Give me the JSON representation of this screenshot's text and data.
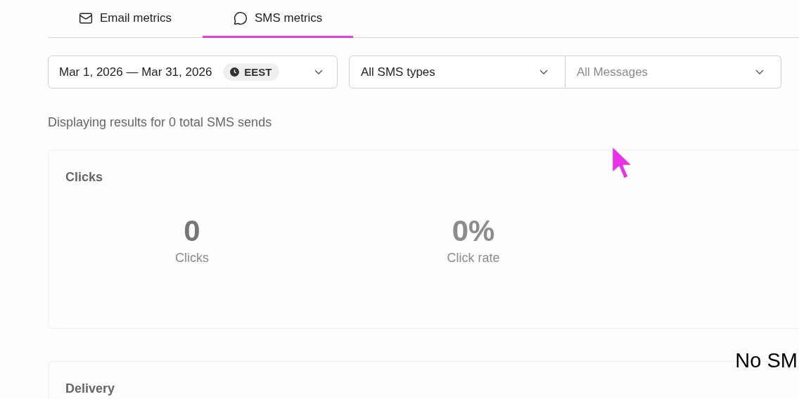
{
  "tabs": [
    {
      "label": "Email metrics",
      "selected": false
    },
    {
      "label": "SMS metrics",
      "selected": true
    }
  ],
  "filters": {
    "date_range": "Mar 1, 2026 — Mar 31, 2026",
    "timezone": "EEST",
    "sms_type": {
      "value": "All SMS types"
    },
    "message": {
      "placeholder": "All Messages"
    }
  },
  "summary": "Displaying results for 0 total SMS sends",
  "cards": [
    {
      "title": "Clicks",
      "stats": [
        {
          "value": "0",
          "label": "Clicks"
        },
        {
          "value": "0%",
          "label": "Click rate"
        }
      ]
    },
    {
      "title": "Delivery"
    }
  ],
  "overlay_text": "No SM"
}
